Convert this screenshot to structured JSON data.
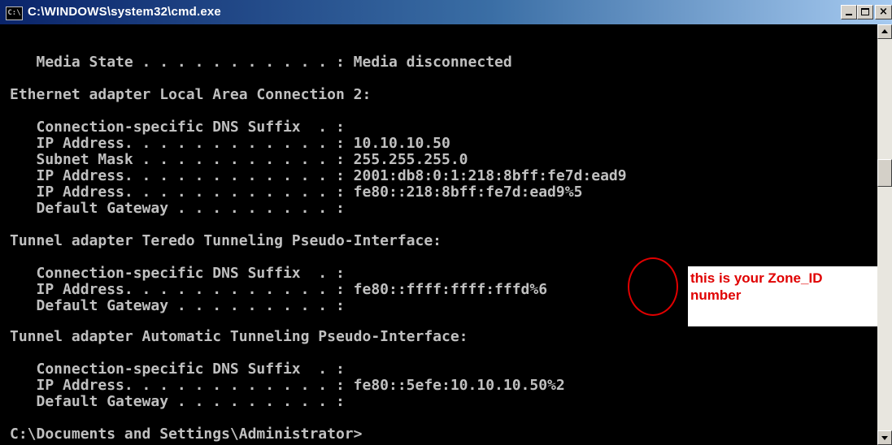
{
  "window": {
    "title": "C:\\WINDOWS\\system32\\cmd.exe",
    "icon_text": "C:\\",
    "icon": "cmd-console-icon"
  },
  "console": {
    "lines": [
      "   Media State . . . . . . . . . . . : Media disconnected",
      "Ethernet adapter Local Area Connection 2:",
      "   Connection-specific DNS Suffix  . :",
      "   IP Address. . . . . . . . . . . . : 10.10.10.50",
      "   Subnet Mask . . . . . . . . . . . : 255.255.255.0",
      "   IP Address. . . . . . . . . . . . : 2001:db8:0:1:218:8bff:fe7d:ead9",
      "   IP Address. . . . . . . . . . . . : fe80::218:8bff:fe7d:ead9%5",
      "   Default Gateway . . . . . . . . . :",
      "Tunnel adapter Teredo Tunneling Pseudo-Interface:",
      "   Connection-specific DNS Suffix  . :",
      "   IP Address. . . . . . . . . . . . : fe80::ffff:ffff:fffd%6",
      "   Default Gateway . . . . . . . . . :",
      "Tunnel adapter Automatic Tunneling Pseudo-Interface:",
      "   Connection-specific DNS Suffix  . :",
      "   IP Address. . . . . . . . . . . . : fe80::5efe:10.10.10.50%2",
      "   Default Gateway . . . . . . . . . :",
      "C:\\Documents and Settings\\Administrator>"
    ]
  },
  "annotation": {
    "line1": "this is your Zone_ID",
    "line2": "number",
    "color": "#e00000"
  },
  "colors": {
    "console_bg": "#000000",
    "console_text": "#c0c0c0",
    "titlebar_start": "#0a246a",
    "titlebar_end": "#a6caf0"
  }
}
